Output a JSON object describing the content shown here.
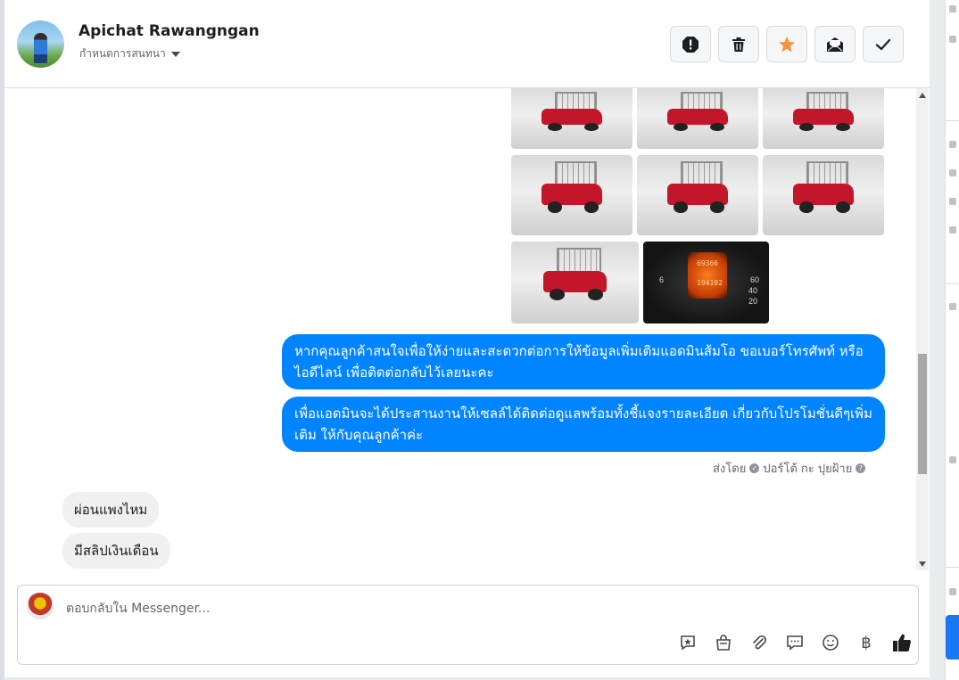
{
  "header": {
    "contact_name": "Apichat Rawangngan",
    "assign_label": "กำหนดการสนทนา",
    "actions": [
      {
        "name": "spam-button",
        "icon": "exclamation-icon"
      },
      {
        "name": "delete-button",
        "icon": "trash-icon"
      },
      {
        "name": "star-button",
        "icon": "star-icon",
        "color": "#f7923b"
      },
      {
        "name": "mark-unread-button",
        "icon": "envelope-open-icon"
      },
      {
        "name": "mark-done-button",
        "icon": "check-icon"
      }
    ]
  },
  "thread": {
    "photo_grid": {
      "count": 8,
      "gauge_odometer": "194102",
      "gauge_trip": "69366"
    },
    "outgoing_messages": [
      {
        "text": "หากคุณลูกค้าสนใจเพื่อให้ง่ายและสะดวกต่อการให้ข้อมูลเพิ่มเติมแอดมินส้มโอ ขอเบอร์โทรศัพท์ หรือ ไอดีไลน์ เพื่อติดต่อกลับไว้เลยนะคะ"
      },
      {
        "text": "เพื่อแอดมินจะได้ประสานงานให้เซลล์ได้ติดต่อดูแลพร้อมทั้งชี้แจงรายละเอียด เกี่ยวกับโปรโมชั่นดีๆเพิ่มเติม ให้กับคุณลูกค้าค่ะ"
      }
    ],
    "sent_by": {
      "prefix": "ส่งโดย",
      "name": "ปอร์โต้ กะ ปุยฝ้าย"
    },
    "incoming_messages": [
      {
        "text": "ผ่อนแพงไหม"
      },
      {
        "text": "มีสลิปเงินเดือน"
      }
    ]
  },
  "composer": {
    "placeholder": "ตอบกลับใน Messenger...",
    "tools": [
      "saved-reply-icon",
      "shop-bag-icon",
      "attachment-icon",
      "chat-bubbles-icon",
      "emoji-icon",
      "baht-icon",
      "thumbs-up-icon"
    ],
    "baht_symbol": "฿"
  },
  "colors": {
    "outgoing_bubble": "#0084ff",
    "incoming_bubble": "#f1f0f0",
    "accent_star": "#f7923b"
  }
}
